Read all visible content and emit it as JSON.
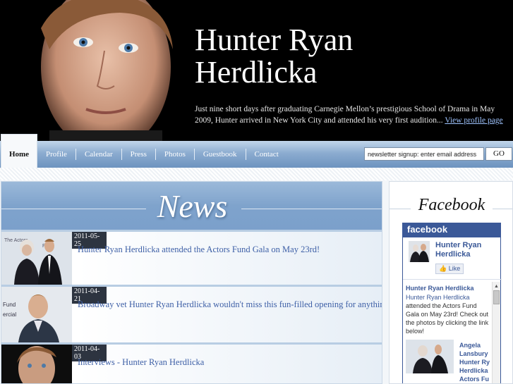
{
  "header": {
    "title_line1": "Hunter Ryan",
    "title_line2": "Herdlicka",
    "intro_text": "Just nine short days after graduating Carnegie Mellon’s prestigious School of Drama in May 2009, Hunter arrived in New York City and attended his very first audition... ",
    "intro_link": "View profile page"
  },
  "nav": {
    "home": "Home",
    "items": [
      "Profile",
      "Calendar",
      "Press",
      "Photos",
      "Guestbook",
      "Contact"
    ],
    "newsletter_value": "newsletter signup: enter email address",
    "go_label": "GO"
  },
  "news": {
    "title": "News",
    "items": [
      {
        "date": "2011-05-25",
        "headline": "Hunter Ryan Herdlicka attended the Actors Fund Gala on May 23rd!"
      },
      {
        "date": "2011-04-21",
        "headline": "Broadway vet Hunter Ryan Herdlicka wouldn't miss this fun-filled opening for anything."
      },
      {
        "date": "2011-04-03",
        "headline": "Interviews - Hunter Ryan Herdlicka"
      }
    ]
  },
  "facebook": {
    "title": "Facebook",
    "brand": "facebook",
    "page_name_line1": "Hunter Ryan",
    "page_name_line2": "Herdlicka",
    "like_label": "Like",
    "post_author": "Hunter Ryan Herdlicka",
    "post_tag": "Hunter Ryan Herdlicka",
    "post_text": " attended the Actors Fund Gala on May 23rd! Check out the photos by clicking the link below!",
    "link_lines": [
      "Angela",
      "Lansbury",
      "Hunter Ry",
      "Herdlicka",
      "Actors Fu"
    ]
  },
  "colors": {
    "nav_blue": "#7fa3cc",
    "facebook_blue": "#3b5998",
    "headline_blue": "#3d5fa6",
    "date_bg": "#2d3440"
  }
}
